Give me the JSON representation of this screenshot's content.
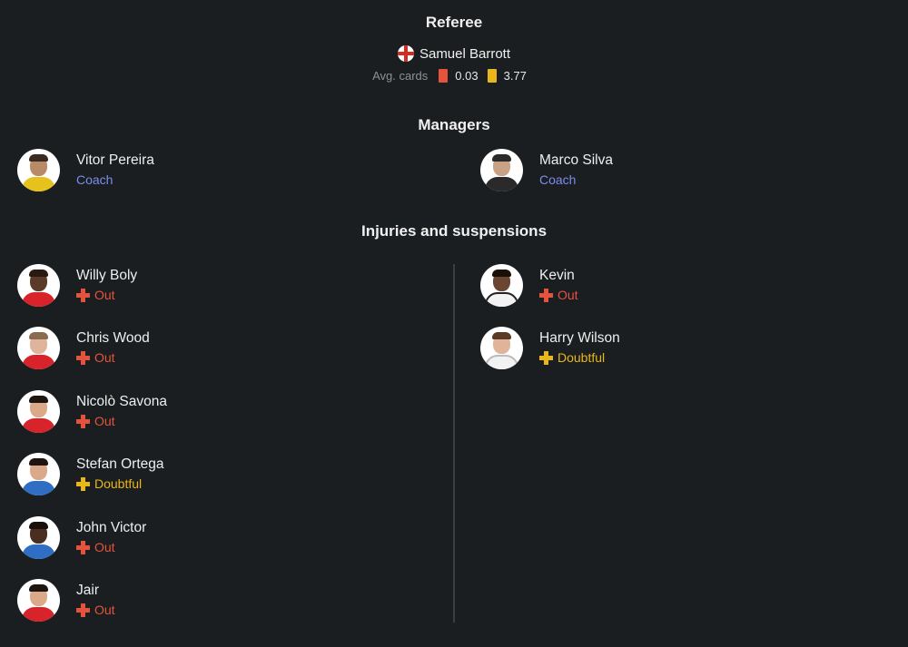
{
  "referee": {
    "title": "Referee",
    "name": "Samuel Barrott",
    "flag_icon": "england-flag-icon",
    "avg_cards_label": "Avg. cards",
    "red_cards": "0.03",
    "yellow_cards": "3.77"
  },
  "managers": {
    "title": "Managers",
    "list": [
      {
        "name": "Vitor Pereira",
        "role": "Coach"
      },
      {
        "name": "Marco Silva",
        "role": "Coach"
      }
    ]
  },
  "injuries": {
    "title": "Injuries and suspensions",
    "home": [
      {
        "name": "Willy Boly",
        "status": "Out"
      },
      {
        "name": "Chris Wood",
        "status": "Out"
      },
      {
        "name": "Nicolò Savona",
        "status": "Out"
      },
      {
        "name": "Stefan Ortega",
        "status": "Doubtful"
      },
      {
        "name": "John Victor",
        "status": "Out"
      },
      {
        "name": "Jair",
        "status": "Out"
      }
    ],
    "away": [
      {
        "name": "Kevin",
        "status": "Out"
      },
      {
        "name": "Harry Wilson",
        "status": "Doubtful"
      }
    ]
  },
  "colors": {
    "background": "#1b1e20",
    "accent_role": "#7d8cf0",
    "out": "#e5533d",
    "doubtful": "#e9b71a"
  }
}
